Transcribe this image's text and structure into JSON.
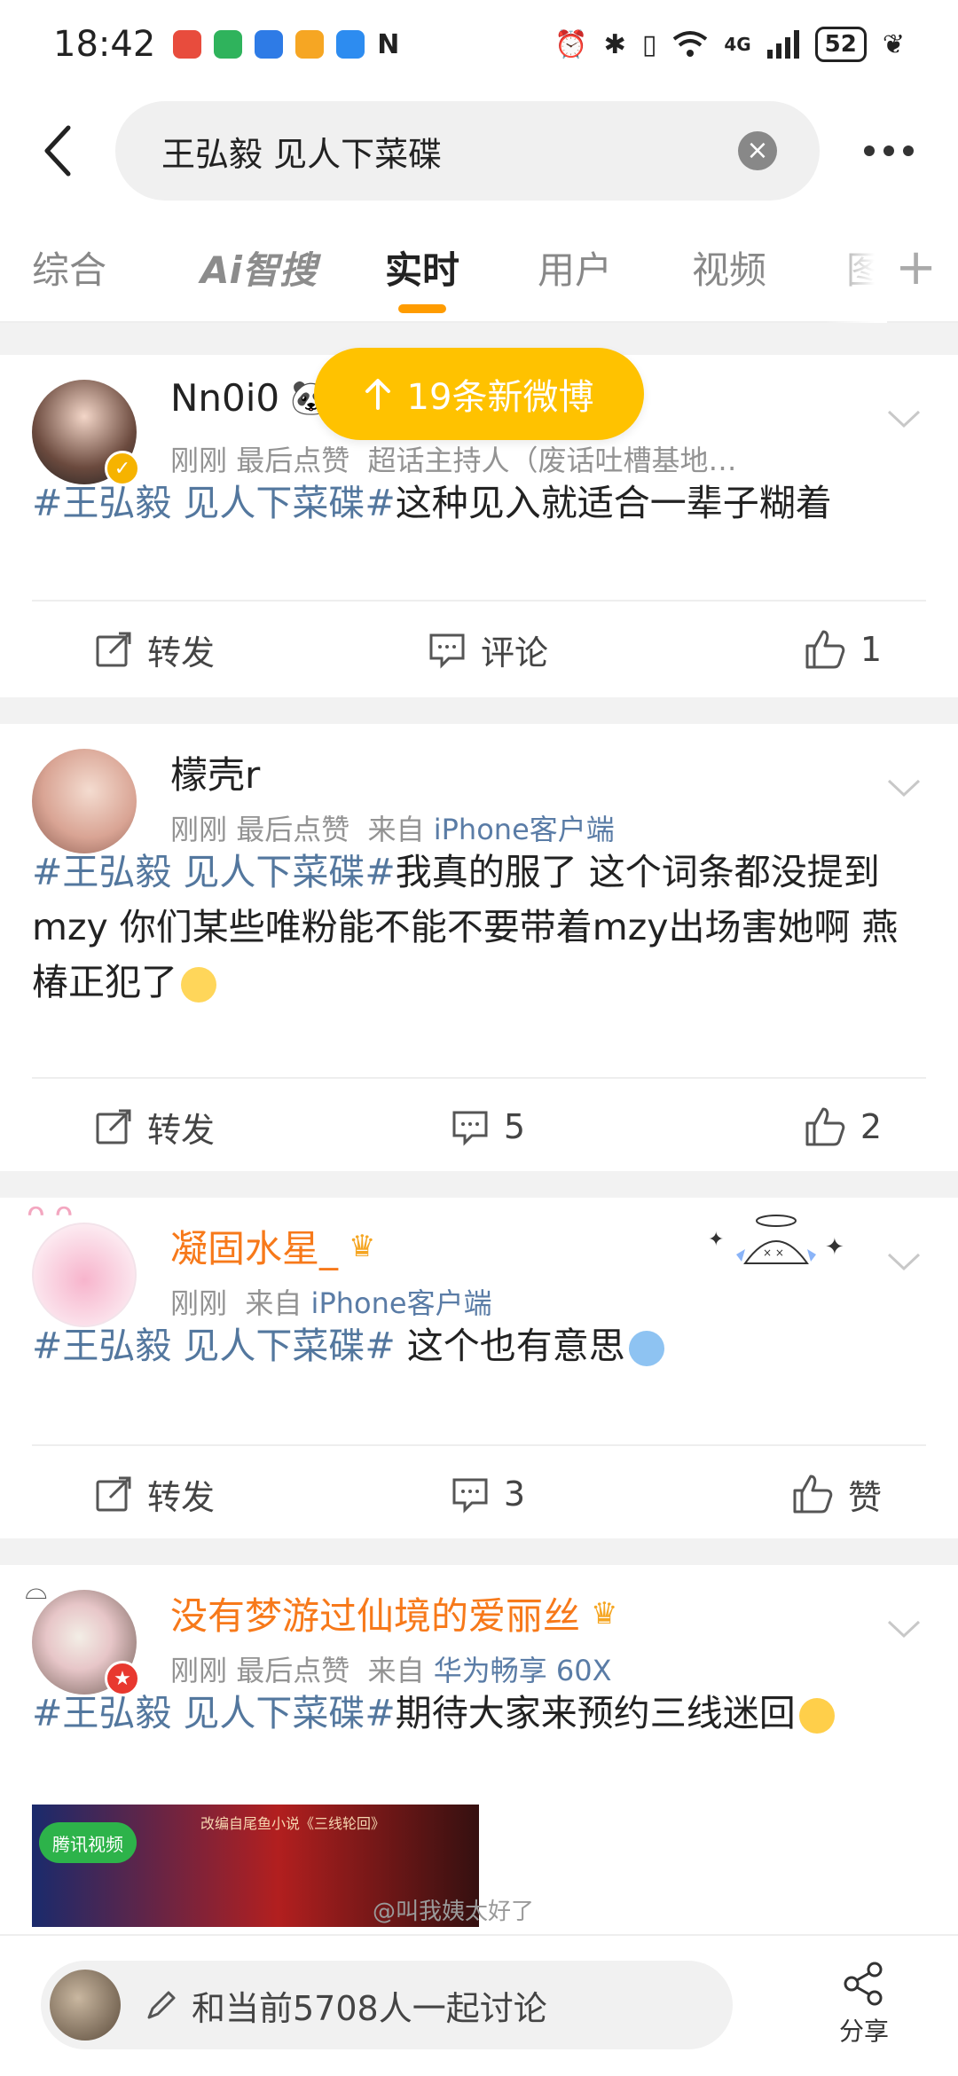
{
  "status": {
    "time": "18:42",
    "battery": "52",
    "network": "4G"
  },
  "search": {
    "query": "王弘毅 见人下菜碟"
  },
  "tabs": [
    {
      "label": "综合"
    },
    {
      "label": "Ai智搜"
    },
    {
      "label": "实时"
    },
    {
      "label": "用户"
    },
    {
      "label": "视频"
    },
    {
      "label": "图"
    }
  ],
  "new_posts": {
    "label": "19条新微博"
  },
  "posts": [
    {
      "username": "Nn0i0",
      "time": "刚刚",
      "meta_extra": "最后点赞",
      "source": "超话主持人（废话吐槽基地…",
      "hashtag": "#王弘毅 见人下菜碟#",
      "text": "这种见入就适合一辈子糊着",
      "repost": "转发",
      "comments": "评论",
      "likes": "1"
    },
    {
      "username": "檬壳r",
      "time": "刚刚",
      "meta_extra": "最后点赞",
      "source_prefix": "来自",
      "source": "iPhone客户端",
      "hashtag": "#王弘毅 见人下菜碟#",
      "text": "我真的服了  这个词条都没提到mzy 你们某些唯粉能不能不要带着mzy出场害她啊 燕椿正犯了",
      "repost": "转发",
      "comments": "5",
      "likes": "2"
    },
    {
      "username": "凝固水星_",
      "time": "刚刚",
      "source_prefix": "来自",
      "source": "iPhone客户端",
      "hashtag": "#王弘毅 见人下菜碟#",
      "text": " 这个也有意思",
      "repost": "转发",
      "comments": "3",
      "likes": "赞"
    },
    {
      "username": "没有梦游过仙境的爱丽丝",
      "time": "刚刚",
      "meta_extra": "最后点赞",
      "source_prefix": "来自",
      "source": "华为畅享 60X",
      "hashtag": "#王弘毅 见人下菜碟#",
      "text": "期待大家来预约三线迷回",
      "thumb_logo": "腾讯视频",
      "thumb_caption": "改编自尾鱼小说《三线轮回》"
    }
  ],
  "bottom": {
    "comment_prompt": "和当前5708人一起讨论",
    "share": "分享",
    "watermark": "@叫我姨太好了"
  },
  "colors": {
    "accent": "#ff9c00",
    "pill": "#ffc200",
    "hashtag": "#53779e",
    "username_vip": "#f7791a"
  }
}
